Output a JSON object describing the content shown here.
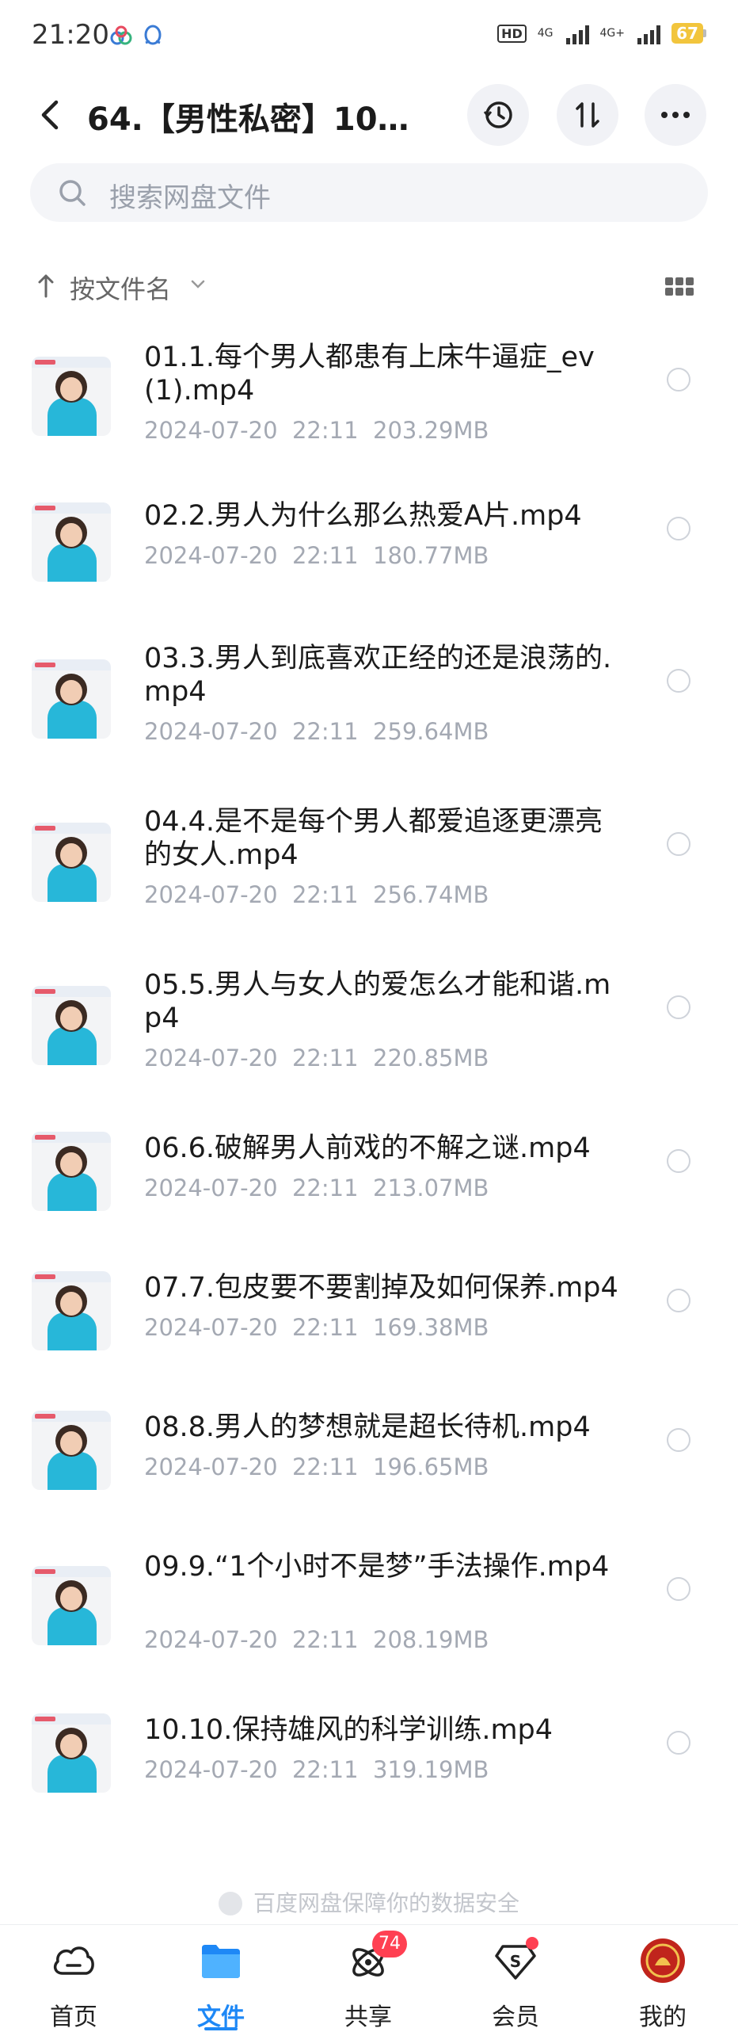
{
  "status_bar": {
    "time": "21:20",
    "hd": "HD",
    "net1": "4G",
    "net2": "4G+",
    "battery": "67"
  },
  "header": {
    "title": "64.【男性私密】10…"
  },
  "search": {
    "placeholder": "搜索网盘文件"
  },
  "sort": {
    "label": "按文件名"
  },
  "files": [
    {
      "name": "01.1.每个男人都患有上床牛逼症_ev(1).mp4",
      "date": "2024-07-20",
      "time": "22:11",
      "size": "203.29MB"
    },
    {
      "name": "02.2.男人为什么那么热爱A片.mp4",
      "date": "2024-07-20",
      "time": "22:11",
      "size": "180.77MB"
    },
    {
      "name": "03.3.男人到底喜欢正经的还是浪荡的.mp4",
      "date": "2024-07-20",
      "time": "22:11",
      "size": "259.64MB"
    },
    {
      "name": "04.4.是不是每个男人都爱追逐更漂亮的女人.mp4",
      "date": "2024-07-20",
      "time": "22:11",
      "size": "256.74MB"
    },
    {
      "name": "05.5.男人与女人的爱怎么才能和谐.mp4",
      "date": "2024-07-20",
      "time": "22:11",
      "size": "220.85MB"
    },
    {
      "name": "06.6.破解男人前戏的不解之谜.mp4",
      "date": "2024-07-20",
      "time": "22:11",
      "size": "213.07MB"
    },
    {
      "name": "07.7.包皮要不要割掉及如何保养.mp4",
      "date": "2024-07-20",
      "time": "22:11",
      "size": "169.38MB"
    },
    {
      "name": "08.8.男人的梦想就是超长待机.mp4",
      "date": "2024-07-20",
      "time": "22:11",
      "size": "196.65MB"
    },
    {
      "name": "09.9.“1个小时不是梦”手法操作.mp4",
      "date": "2024-07-20",
      "time": "22:11",
      "size": "208.19MB"
    },
    {
      "name": "10.10.保持雄风的科学训练.mp4",
      "date": "2024-07-20",
      "time": "22:11",
      "size": "319.19MB"
    }
  ],
  "footer": {
    "safety_text": "百度网盘保障你的数据安全"
  },
  "bottom_nav": [
    {
      "label": "首页",
      "icon": "cloud-home-icon"
    },
    {
      "label": "文件",
      "icon": "folder-icon",
      "active": true
    },
    {
      "label": "共享",
      "icon": "share-orbit-icon",
      "badge": "74"
    },
    {
      "label": "会员",
      "icon": "vip-diamond-icon",
      "dot": true
    },
    {
      "label": "我的",
      "icon": "avatar"
    }
  ],
  "colors": {
    "accent": "#1e88f6",
    "badge": "#ff4052",
    "meta_text": "#a4a9b3",
    "battery": "#f2c53d"
  }
}
